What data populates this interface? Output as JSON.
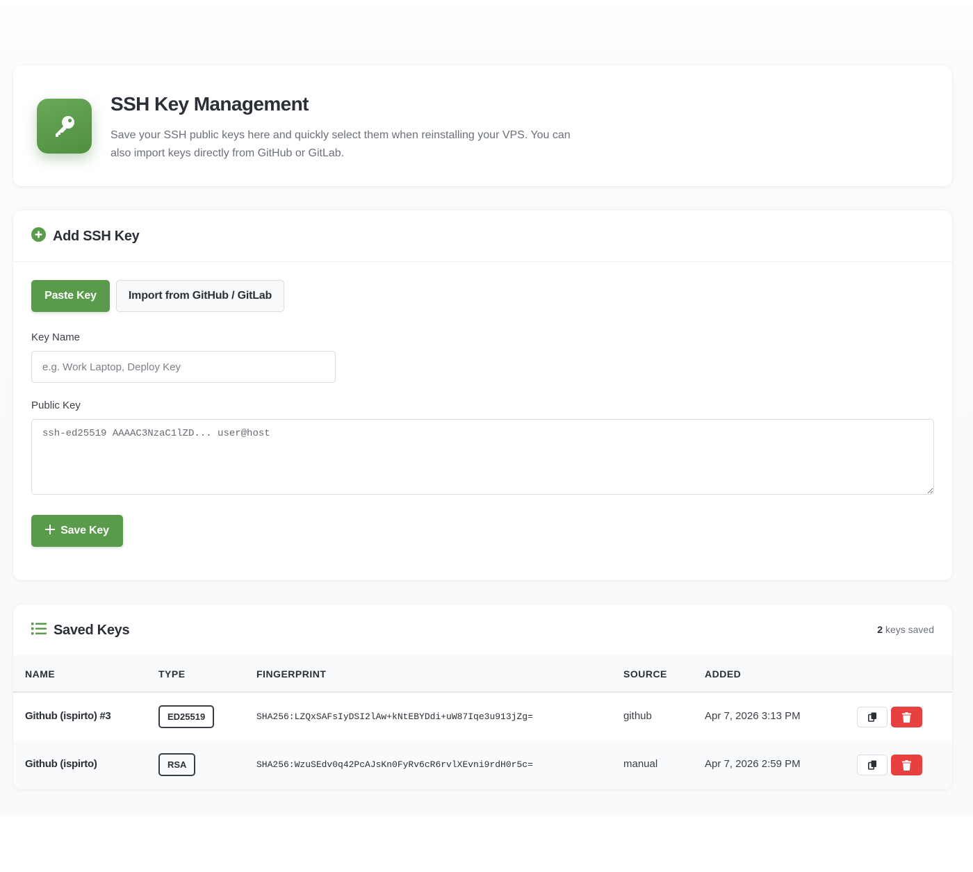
{
  "header": {
    "title": "SSH Key Management",
    "description": "Save your SSH public keys here and quickly select them when reinstalling your VPS. You can also import keys directly from GitHub or GitLab.",
    "icon": "key-icon"
  },
  "add_section": {
    "title": "Add SSH Key",
    "icon": "plus-circle-icon",
    "tabs": [
      {
        "label": "Paste Key",
        "active": true
      },
      {
        "label": "Import from GitHub / GitLab",
        "active": false
      }
    ],
    "key_name": {
      "label": "Key Name",
      "placeholder": "e.g. Work Laptop, Deploy Key",
      "value": ""
    },
    "public_key": {
      "label": "Public Key",
      "placeholder": "ssh-ed25519 AAAAC3NzaC1lZD... user@host",
      "value": ""
    },
    "save_label": "Save Key"
  },
  "saved_section": {
    "title": "Saved Keys",
    "icon": "list-icon",
    "count": "2",
    "count_suffix": " keys saved",
    "columns": [
      "NAME",
      "TYPE",
      "FINGERPRINT",
      "SOURCE",
      "ADDED"
    ],
    "rows": [
      {
        "name": "Github (ispirto) #3",
        "type": "ED25519",
        "fingerprint": "SHA256:LZQxSAFsIyDSI2lAw+kNtEBYDdi+uW87Iqe3u913jZg=",
        "source": "github",
        "added": "Apr 7, 2026 3:13 PM"
      },
      {
        "name": "Github (ispirto)",
        "type": "RSA",
        "fingerprint": "SHA256:WzuSEdv0q42PcAJsKn0FyRv6cR6rvlXEvni9rdH0r5c=",
        "source": "manual",
        "added": "Apr 7, 2026 2:59 PM"
      }
    ]
  },
  "colors": {
    "accent": "#5a9a4b",
    "danger": "#e8403f",
    "text": "#2b2f37",
    "muted": "#6b7079"
  }
}
